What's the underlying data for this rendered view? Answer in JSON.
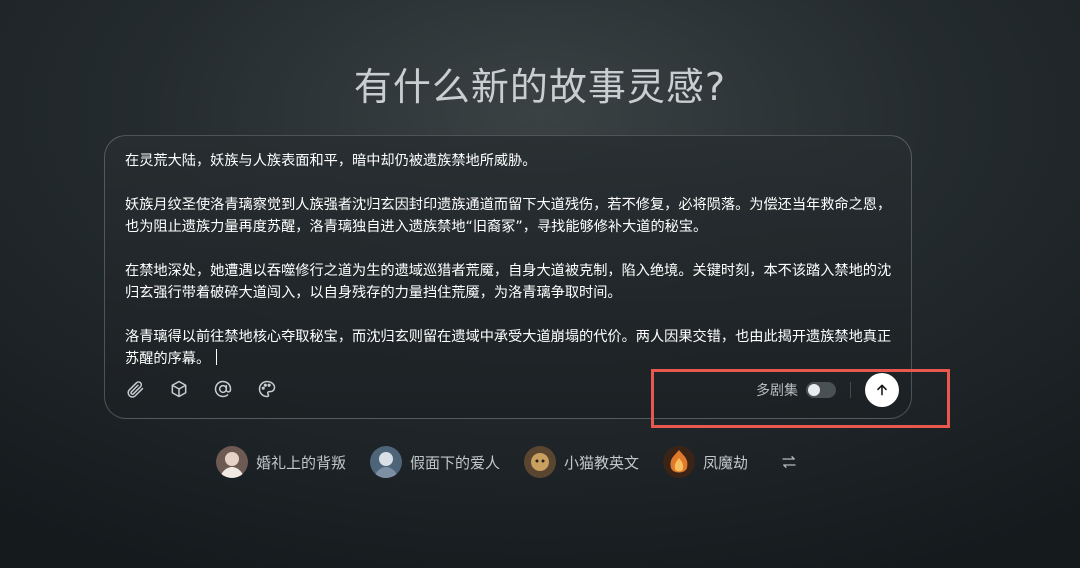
{
  "title": "有什么新的故事灵感?",
  "composer": {
    "paragraphs": [
      "在灵荒大陆，妖族与人族表面和平，暗中却仍被遗族禁地所威胁。",
      "妖族月纹圣使洛青璃察觉到人族强者沈归玄因封印遗族通道而留下大道残伤，若不修复，必将陨落。为偿还当年救命之恩，也为阻止遗族力量再度苏醒，洛青璃独自进入遗族禁地“旧裔冢”，寻找能够修补大道的秘宝。",
      "在禁地深处，她遭遇以吞噬修行之道为生的遗域巡猎者荒魇，自身大道被克制，陷入绝境。关键时刻，本不该踏入禁地的沈归玄强行带着破碎大道闯入，以自身残存的力量挡住荒魇，为洛青璃争取时间。",
      "洛青璃得以前往禁地核心夺取秘宝，而沈归玄则留在遗域中承受大道崩塌的代价。两人因果交错，也由此揭开遗族禁地真正苏醒的序幕。"
    ],
    "toolbar_icons": [
      "paperclip-icon",
      "cube-icon",
      "at-icon",
      "palette-icon"
    ],
    "toggle_label": "多剧集",
    "toggle_on": false,
    "send_icon": "arrow-up-icon"
  },
  "colors": {
    "highlight": "#e8584f",
    "send_bg": "#ffffff"
  },
  "suggestions": [
    {
      "label": "婚礼上的背叛",
      "avatar": "#c9b8ae"
    },
    {
      "label": "假面下的爱人",
      "avatar": "#8fa3b8"
    },
    {
      "label": "小猫教英文",
      "avatar": "#b08a52"
    },
    {
      "label": "凤魔劫",
      "avatar": "#d0702a"
    }
  ],
  "swap_icon": "swap-arrows-icon"
}
